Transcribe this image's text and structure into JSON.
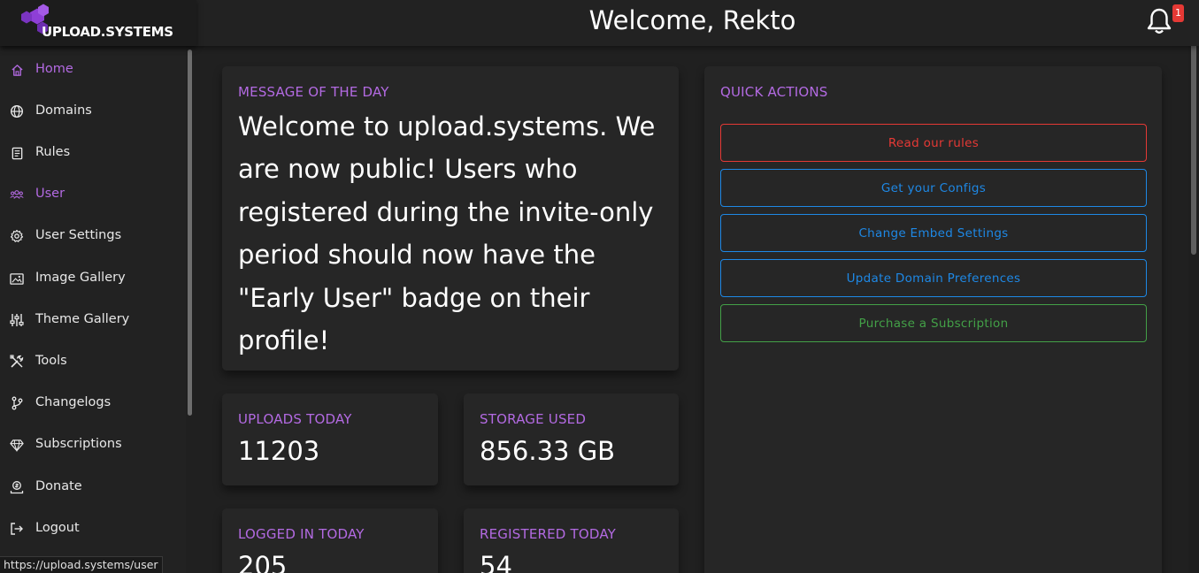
{
  "header": {
    "brand": "UPLOAD.SYSTEMS",
    "welcome": "Welcome, Rekto",
    "notification_count": "1",
    "bell_icon": "bell-icon"
  },
  "sidebar": {
    "items": [
      {
        "label": "Home",
        "icon": "home-icon",
        "active": true
      },
      {
        "label": "Domains",
        "icon": "globe-icon",
        "active": false
      },
      {
        "label": "Rules",
        "icon": "document-icon",
        "active": false
      },
      {
        "label": "User",
        "icon": "users-icon",
        "active": true
      },
      {
        "label": "User Settings",
        "icon": "gear-icon",
        "active": false
      },
      {
        "label": "Image Gallery",
        "icon": "image-icon",
        "active": false
      },
      {
        "label": "Theme Gallery",
        "icon": "sliders-icon",
        "active": false
      },
      {
        "label": "Tools",
        "icon": "tools-icon",
        "active": false
      },
      {
        "label": "Changelogs",
        "icon": "branch-icon",
        "active": false
      },
      {
        "label": "Subscriptions",
        "icon": "diamond-icon",
        "active": false
      },
      {
        "label": "Donate",
        "icon": "donate-icon",
        "active": false
      },
      {
        "label": "Logout",
        "icon": "logout-icon",
        "active": false
      }
    ]
  },
  "motd": {
    "title": "MESSAGE OF THE DAY",
    "text": "Welcome to upload.systems. We are now public! Users who registered during the invite-only period should now have the \"Early User\" badge on their profile!"
  },
  "stats": {
    "uploads_today": {
      "label": "UPLOADS TODAY",
      "value": "11203"
    },
    "storage_used": {
      "label": "STORAGE USED",
      "value": "856.33 GB"
    },
    "logged_in_today": {
      "label": "LOGGED IN TODAY",
      "value": "205"
    },
    "registered_today": {
      "label": "REGISTERED TODAY",
      "value": "54"
    }
  },
  "quick_actions": {
    "title": "QUICK ACTIONS",
    "buttons": [
      {
        "label": "Read our rules",
        "color": "#e53935"
      },
      {
        "label": "Get your Configs",
        "color": "#1e88e5"
      },
      {
        "label": "Change Embed Settings",
        "color": "#1e88e5"
      },
      {
        "label": "Update Domain Preferences",
        "color": "#1e88e5"
      },
      {
        "label": "Purchase a Subscription",
        "color": "#43a047"
      }
    ]
  },
  "status_url": "https://upload.systems/user",
  "colors": {
    "accent": "#b36ae2",
    "background": "#202020",
    "card": "#262626"
  }
}
